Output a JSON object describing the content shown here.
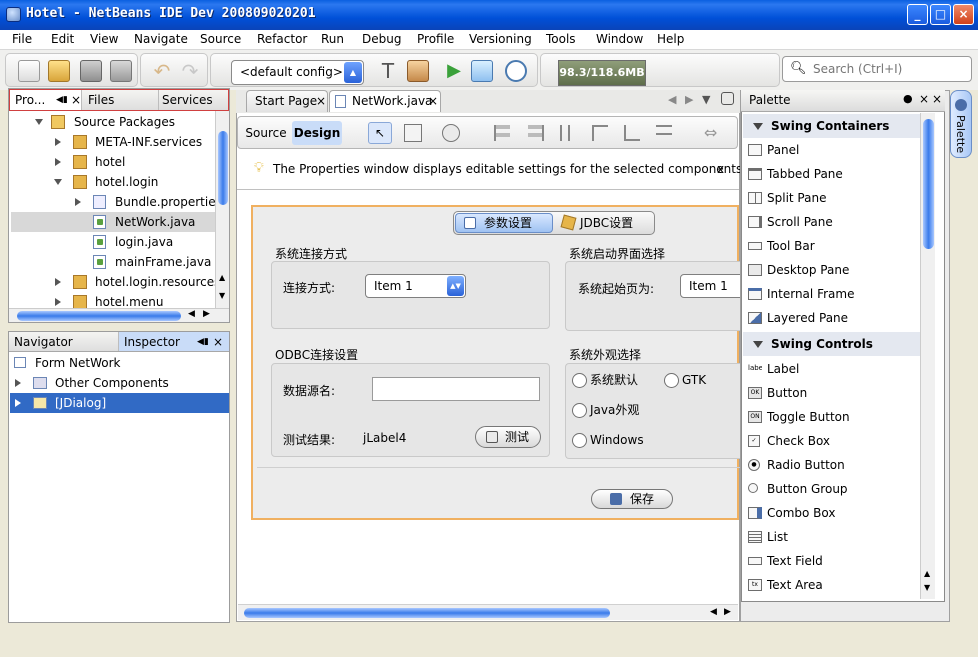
{
  "window": {
    "title": "Hotel - NetBeans IDE Dev 200809020201",
    "minimize": "_",
    "maximize": "□",
    "close": "×"
  },
  "menu": [
    "File",
    "Edit",
    "View",
    "Navigate",
    "Source",
    "Refactor",
    "Run",
    "Debug",
    "Profile",
    "Versioning",
    "Tools",
    "Window",
    "Help"
  ],
  "toolbar": {
    "config": "<default config>",
    "memory": "98.3/118.6MB",
    "search_placeholder": "Search (Ctrl+I)"
  },
  "projects_panel": {
    "tabs": [
      "Pro...",
      "Files",
      "Services"
    ],
    "tree": [
      {
        "label": "Source Packages",
        "icon": "source-packages-icon"
      },
      {
        "label": "META-INF.services",
        "icon": "package-icon"
      },
      {
        "label": "hotel",
        "icon": "package-icon"
      },
      {
        "label": "hotel.login",
        "icon": "package-icon"
      },
      {
        "label": "Bundle.properties",
        "icon": "properties-file-icon"
      },
      {
        "label": "NetWork.java",
        "icon": "java-file-icon"
      },
      {
        "label": "login.java",
        "icon": "java-file-icon"
      },
      {
        "label": "mainFrame.java",
        "icon": "java-file-icon"
      },
      {
        "label": "hotel.login.resources",
        "icon": "package-icon"
      },
      {
        "label": "hotel.menu",
        "icon": "package-icon"
      }
    ]
  },
  "inspector_panel": {
    "tabs": [
      "Navigator",
      "Inspector"
    ],
    "tree": [
      {
        "label": "Form NetWork"
      },
      {
        "label": "Other Components"
      },
      {
        "label": "[JDialog]"
      }
    ]
  },
  "editor": {
    "tabs": [
      "Start Page",
      "NetWork.java"
    ],
    "view_source": "Source",
    "view_design": "Design",
    "info_message": "The Properties window displays editable settings for the selected components.",
    "info_close": "x"
  },
  "form": {
    "tabs": [
      "参数设置",
      "JDBC设置"
    ],
    "connection_group": "系统连接方式",
    "connection_label": "连接方式:",
    "connection_value": "Item 1",
    "startup_group": "系统启动界面选择",
    "startup_label": "系统起始页为:",
    "startup_value": "Item 1",
    "odbc_group": "ODBC连接设置",
    "datasource_label": "数据源名:",
    "datasource_value": "",
    "test_result_label": "测试结果:",
    "test_result_value": "jLabel4",
    "test_button": "测试",
    "appearance_group": "系统外观选择",
    "radios": [
      "系统默认",
      "GTK",
      "Java外观",
      "Windows"
    ],
    "save_button": "保存"
  },
  "palette": {
    "title": "Palette",
    "side_tab": "Palette",
    "sections": [
      {
        "title": "Swing Containers",
        "items": [
          "Panel",
          "Tabbed Pane",
          "Split Pane",
          "Scroll Pane",
          "Tool Bar",
          "Desktop Pane",
          "Internal Frame",
          "Layered Pane"
        ]
      },
      {
        "title": "Swing Controls",
        "items": [
          "Label",
          "Button",
          "Toggle Button",
          "Check Box",
          "Radio Button",
          "Button Group",
          "Combo Box",
          "List",
          "Text Field",
          "Text Area"
        ]
      }
    ],
    "icon_glyphs": {
      "label": "label",
      "button": "OK",
      "toggle": "ON",
      "textarea": "tx"
    }
  },
  "colors": {
    "titlebar": "#0050d8",
    "selection": "#316ac5",
    "form_border": "#f0b060",
    "tab_active": "#c9dcf8"
  }
}
